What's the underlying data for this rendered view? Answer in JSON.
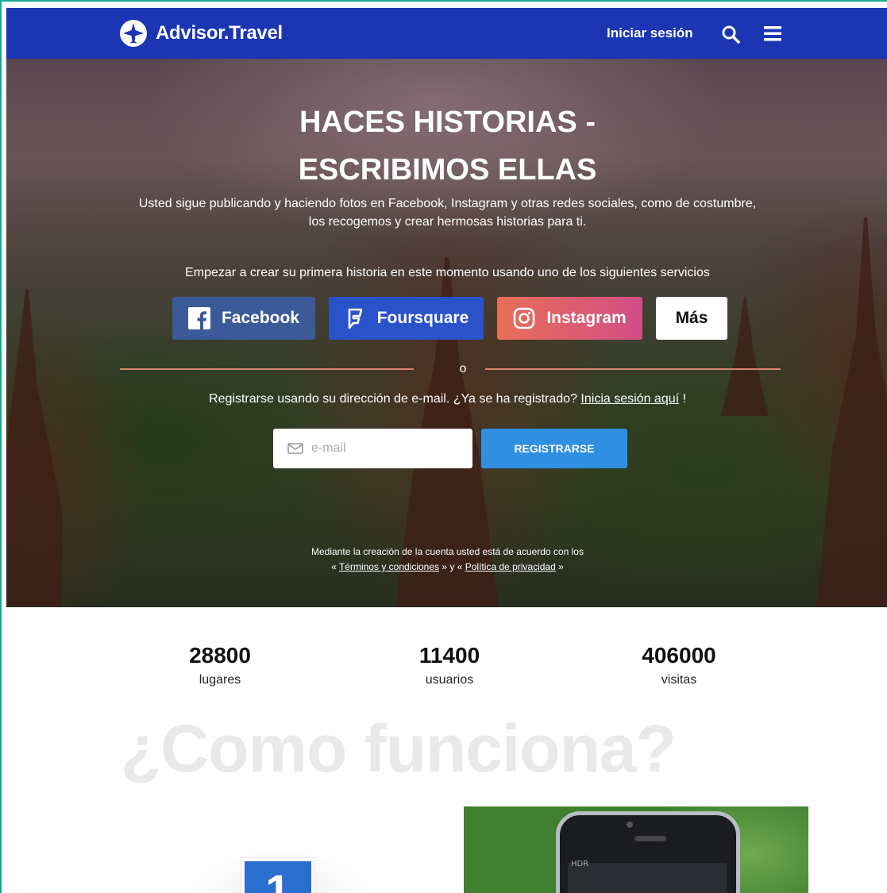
{
  "header": {
    "brand": "Advisor.Travel",
    "signin_label": "Iniciar sesión",
    "icons": [
      "logo-plane-icon",
      "search-icon",
      "menu-icon"
    ],
    "bg_color": "#1b35b3"
  },
  "hero": {
    "title_line1": "HACES HISTORIAS -",
    "title_line2": "ESCRIBIMOS ELLAS",
    "subtitle_line1": "Usted sigue publicando y haciendo fotos en Facebook, Instagram y otras redes sociales, como de costumbre,",
    "subtitle_line2": "los recogemos y crear hermosas historias para ti.",
    "start_text": "Empezar a crear su primera historia en este momento usando uno de los siguientes servicios",
    "services": {
      "facebook": "Facebook",
      "foursquare": "Foursquare",
      "instagram": "Instagram",
      "more": "Más"
    },
    "or_text": "o",
    "register_text": "Registrarse usando su dirección de e-mail. ¿Ya se ha registrado? ",
    "login_here": "Inicia sesión aquí",
    "register_suffix": " !",
    "email_placeholder": "e-mail",
    "register_button": "REGISTRARSE",
    "terms_line1": "Mediante la creación de la cuenta usted está de acuerdo con los",
    "terms_prefix": "« ",
    "terms_link": "Términos y condiciones",
    "terms_mid": " » y « ",
    "privacy_link": "Política de privacidad",
    "terms_suffix": " »"
  },
  "stats": [
    {
      "value": "28800",
      "label": "lugares"
    },
    {
      "value": "11400",
      "label": "usuarios"
    },
    {
      "value": "406000",
      "label": "visitas"
    }
  ],
  "how": {
    "title": "¿Como funciona?",
    "step_number": "1",
    "phone_text": "HDR"
  }
}
